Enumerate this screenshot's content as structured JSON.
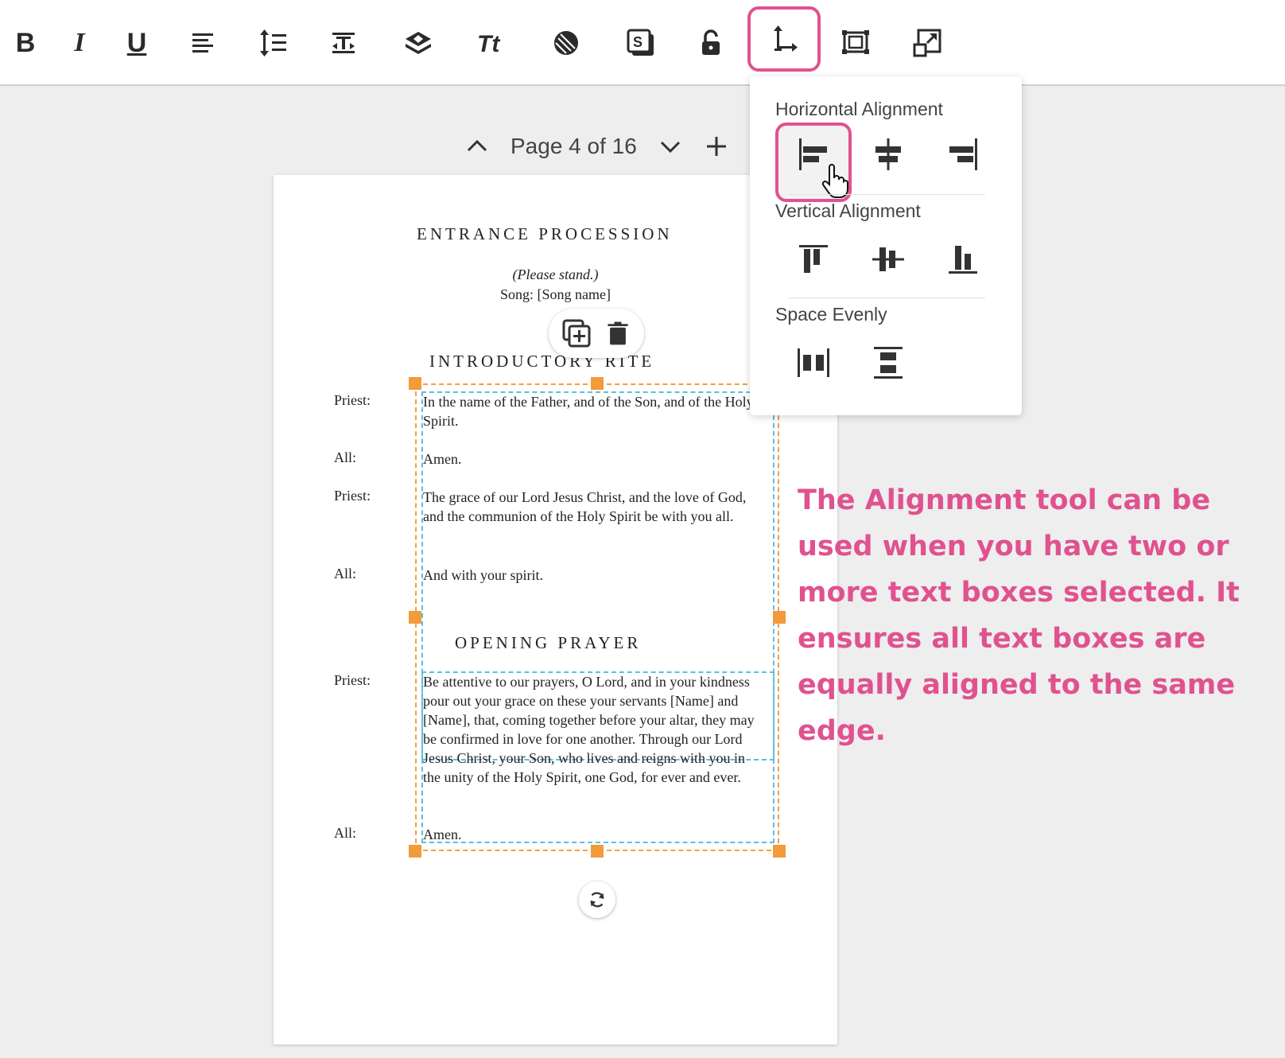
{
  "toolbar": {
    "bold_label": "B",
    "italic_label": "I",
    "underline_label": "U",
    "items": [
      "bold-icon",
      "italic-icon",
      "underline-icon",
      "align-left-icon",
      "line-spacing-icon",
      "text-box-icon",
      "layers-icon",
      "font-size-icon",
      "fill-pattern-icon",
      "style-icon",
      "lock-icon",
      "alignment-tool-icon",
      "fit-frame-icon",
      "resize-icon"
    ]
  },
  "page_nav": {
    "label": "Page 4 of 16"
  },
  "document": {
    "heading1": "ENTRANCE PROCESSION",
    "instruction": "(Please stand.)",
    "song": "Song: [Song name]",
    "heading2": "INTRODUCTORY RITE",
    "heading3": "OPENING PRAYER",
    "rows": [
      {
        "speaker": "Priest:",
        "text": "In the name of the Father, and of the Son, and of the Holy Spirit."
      },
      {
        "speaker": "All:",
        "text": "Amen."
      },
      {
        "speaker": "Priest:",
        "text": "The grace of our Lord Jesus Christ, and the love of God, and the communion of the Holy Spirit be with you all."
      },
      {
        "speaker": "All:",
        "text": "And with your spirit."
      },
      {
        "speaker": "Priest:",
        "text": "Be attentive to our prayers, O Lord, and in your kindness pour out your grace on these your servants [Name] and [Name], that, coming together before your altar, they may be confirmed in love for one another. Through our Lord Jesus Christ, your Son, who lives and reigns with you in the unity of the Holy Spirit, one God, for ever and ever."
      },
      {
        "speaker": "All:",
        "text": "Amen."
      }
    ]
  },
  "alignment_menu": {
    "horizontal_title": "Horizontal Alignment",
    "vertical_title": "Vertical Alignment",
    "space_title": "Space Evenly"
  },
  "annotation": {
    "text": "The Alignment tool can be used when you have two or more text boxes selected. It ensures all text boxes are equally aligned to the same edge."
  },
  "colors": {
    "highlight": "#e0528f",
    "selection_orange": "#f39a3a",
    "selection_blue": "#5bc0e0"
  }
}
